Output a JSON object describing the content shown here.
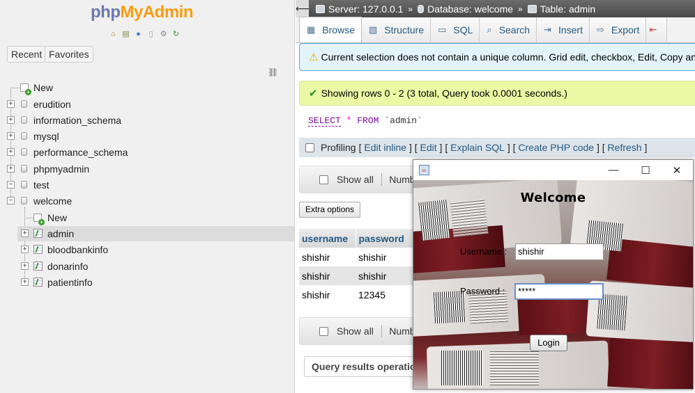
{
  "logo": {
    "php": "php",
    "my": "MyAdmin"
  },
  "nav": {
    "recent_label": "Recent",
    "favorites_label": "Favorites",
    "tree": {
      "new_label": "New",
      "databases": [
        "erudition",
        "information_schema",
        "mysql",
        "performance_schema",
        "phpmyadmin",
        "test",
        "welcome"
      ],
      "welcome_children": {
        "new_label": "New",
        "tables": [
          "admin",
          "bloodbankinfo",
          "donarinfo",
          "patientinfo"
        ]
      }
    }
  },
  "breadcrumb": {
    "server": "Server: 127.0.0.1",
    "database": "Database: welcome",
    "table": "Table: admin"
  },
  "tabs": [
    "Browse",
    "Structure",
    "SQL",
    "Search",
    "Insert",
    "Export"
  ],
  "warning": "Current selection does not contain a unique column. Grid edit, checkbox, Edit, Copy and Del",
  "success": "Showing rows 0 - 2 (3 total, Query took 0.0001 seconds.)",
  "sql": {
    "select": "SELECT",
    "star": "*",
    "from": "FROM",
    "table": "`admin`"
  },
  "profiling": {
    "label": "Profiling",
    "links": [
      "Edit inline",
      "Edit",
      "Explain SQL",
      "Create PHP code",
      "Refresh"
    ]
  },
  "show_all": {
    "label": "Show all",
    "number": "Number"
  },
  "extra_options": "Extra options",
  "table": {
    "headers": [
      "username",
      "password"
    ],
    "rows": [
      [
        "shishir",
        "shishir"
      ],
      [
        "shishir",
        "shishir"
      ],
      [
        "shishir",
        "12345"
      ]
    ]
  },
  "query_results": "Query results operations",
  "java": {
    "welcome": "Welcome",
    "username_label": "Username :",
    "username_value": "shishir",
    "password_label": "Password :",
    "password_value": "*****",
    "login_label": "Login"
  }
}
